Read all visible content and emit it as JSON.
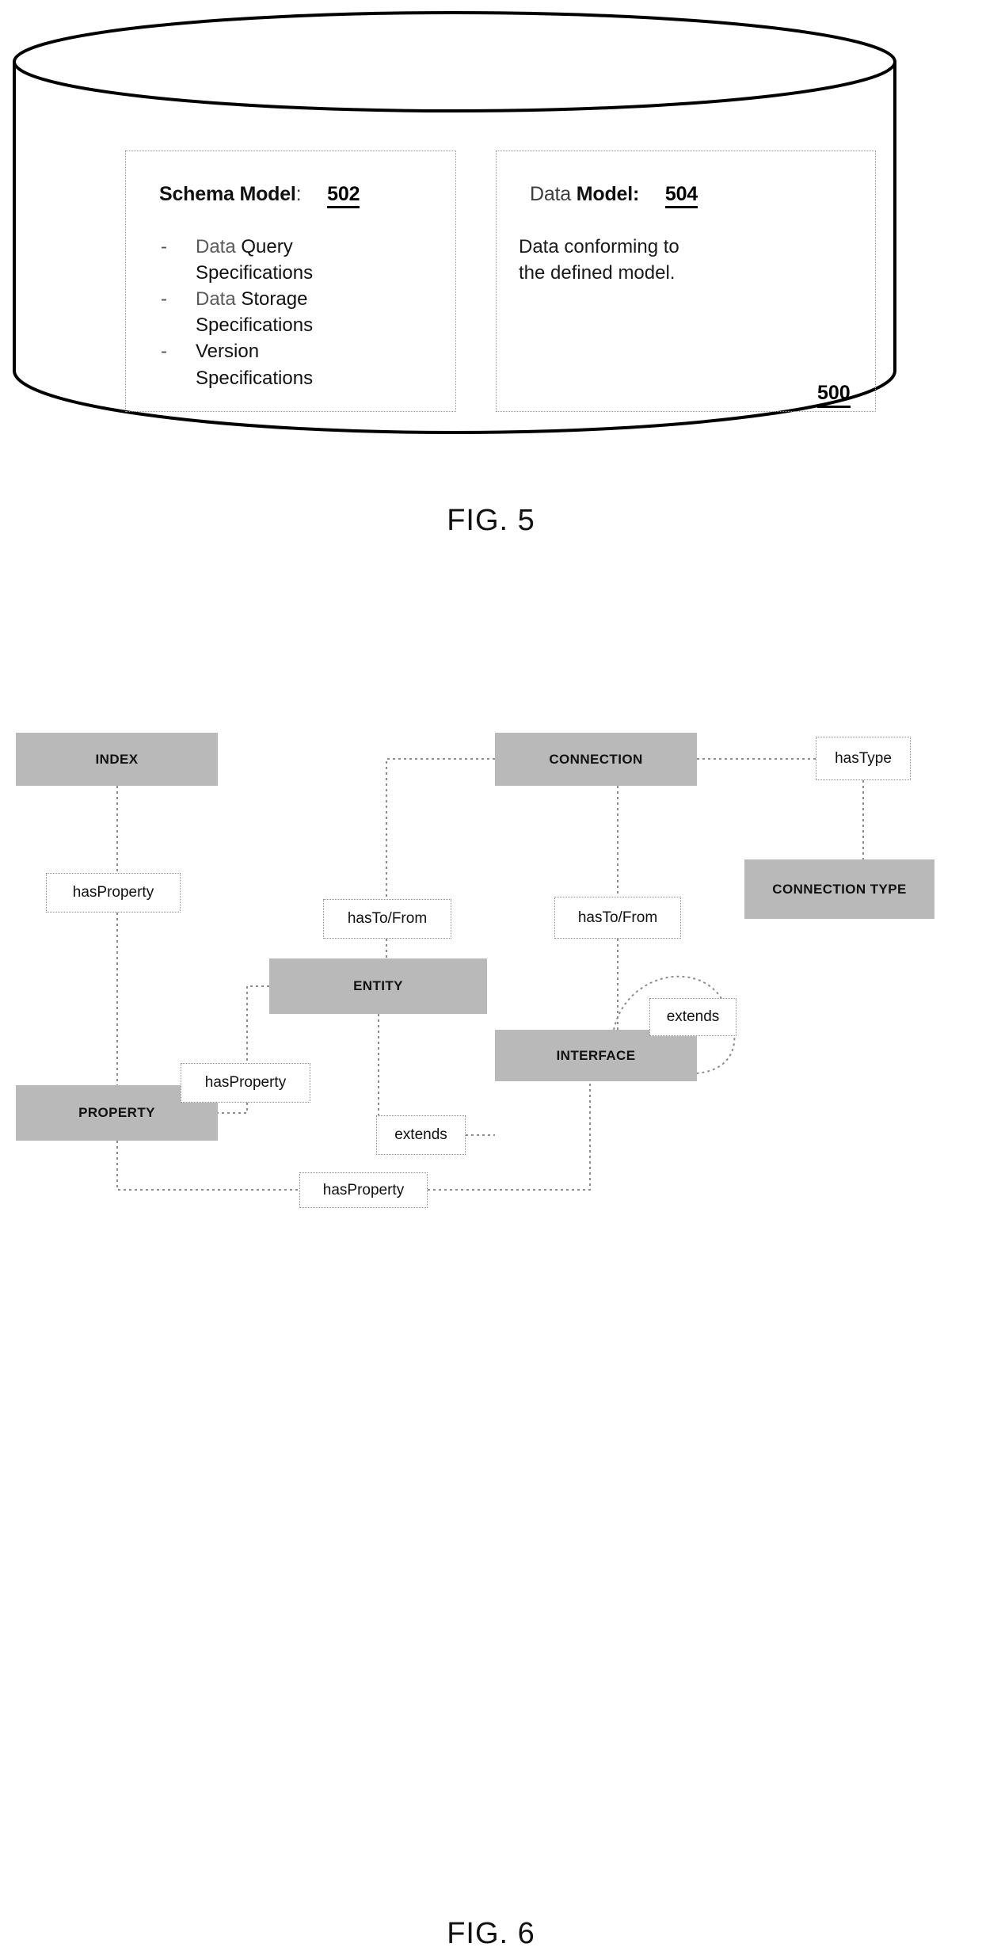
{
  "fig5": {
    "caption": "FIG. 5",
    "overall_ref": "500",
    "schema_panel": {
      "heading_soft": "Schema",
      "heading_bold": "Model",
      "heading_colon": ":",
      "ref": "502",
      "items": [
        {
          "soft": "Data",
          "bold": "Query",
          "second_line": "Specifications"
        },
        {
          "soft": "Data",
          "bold": "Storage",
          "second_line": "Specifications"
        },
        {
          "soft": "",
          "bold": "Version",
          "second_line": "Specifications"
        }
      ]
    },
    "data_panel": {
      "heading_soft": "Data",
      "heading_bold": "Model",
      "heading_colon": ":",
      "ref": "504",
      "body_line1": "Data conforming to",
      "body_line2": "the defined model."
    }
  },
  "fig6": {
    "caption": "FIG. 6",
    "node_fill": "#b9b9b9",
    "nodes": [
      {
        "id": "index",
        "label": "INDEX"
      },
      {
        "id": "connection",
        "label": "CONNECTION"
      },
      {
        "id": "connection-type",
        "label": "CONNECTION TYPE"
      },
      {
        "id": "entity",
        "label": "ENTITY"
      },
      {
        "id": "interface",
        "label": "INTERFACE"
      },
      {
        "id": "property",
        "label": "PROPERTY"
      }
    ],
    "edge_labels": [
      {
        "id": "has-type",
        "label": "hasType"
      },
      {
        "id": "has-to-from-entity",
        "label": "hasTo/From"
      },
      {
        "id": "has-to-from-iface",
        "label": "hasTo/From"
      },
      {
        "id": "has-property-index",
        "label": "hasProperty"
      },
      {
        "id": "has-property-entity",
        "label": "hasProperty"
      },
      {
        "id": "has-property-iface",
        "label": "hasProperty"
      },
      {
        "id": "extends-entity",
        "label": "extends"
      },
      {
        "id": "extends-self",
        "label": "extends"
      }
    ]
  }
}
